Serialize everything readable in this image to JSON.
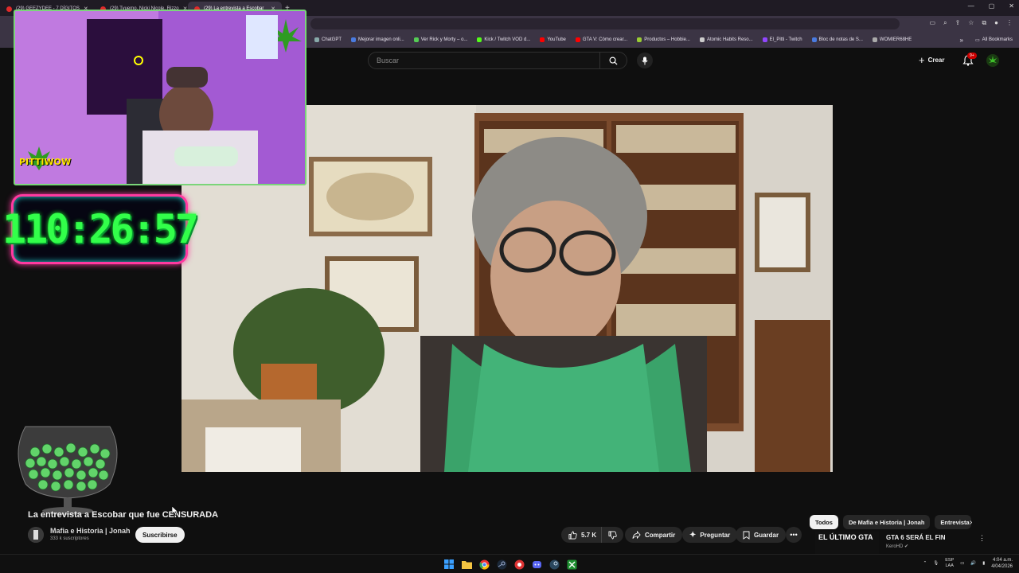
{
  "browser": {
    "tabs": [
      {
        "label": "(29) GEEZYDEE - 7 DÍGITOS",
        "active": false
      },
      {
        "label": "(29) Tyuemo, Nicki Nicole, Rizzo",
        "active": false
      },
      {
        "label": "(29) La entrevista a Escobar",
        "active": true
      }
    ],
    "bookmarks": [
      "ChatGPT",
      "Mejorar imagen onli...",
      "Ver Rick y Morty – o...",
      "Kick / Twitch VOD d...",
      "YouTube",
      "GTA V: Cómo crear...",
      "Productos – Hobbie...",
      "Atomic Habits Reso...",
      "El_Pitti - Twitch",
      "Bloc de notas de S...",
      "WOMIER68HE"
    ],
    "all_bookmarks": "All Bookmarks"
  },
  "header": {
    "search_placeholder": "Buscar",
    "create_label": "Crear",
    "notifications_count": "9+"
  },
  "overlay": {
    "timer": "110:26:57",
    "webcam_logo": "PITTIWOW"
  },
  "video": {
    "title": "La entrevista a Escobar que fue CENSURADA",
    "channel_name": "Mafia e Historia | Jonah",
    "subscriber_count": "333 k suscriptores",
    "subscribe_label": "Suscribirse",
    "like_count": "5.7 K",
    "share_label": "Compartir",
    "ask_label": "Preguntar",
    "save_label": "Guardar"
  },
  "sidebar": {
    "chips": [
      {
        "label": "Todos",
        "active": true
      },
      {
        "label": "De Mafia e Historia | Jonah",
        "active": false
      },
      {
        "label": "Entrevista",
        "active": false
      }
    ],
    "recommendation": {
      "thumb_text": "EL ÚLTIMO GTA",
      "title": "GTA 6 SERÁ EL FIN",
      "channel": "KeroHD"
    }
  },
  "taskbar": {
    "lang_top": "ESP",
    "lang_bottom": "LAA",
    "time": "4:04 a.m.",
    "date": "4/04/2026"
  },
  "colors": {
    "accent_red": "#cc0000",
    "timer_green": "#32ff4a",
    "timer_border": "#ff3aa0",
    "webcam_border": "#7bd57a"
  }
}
